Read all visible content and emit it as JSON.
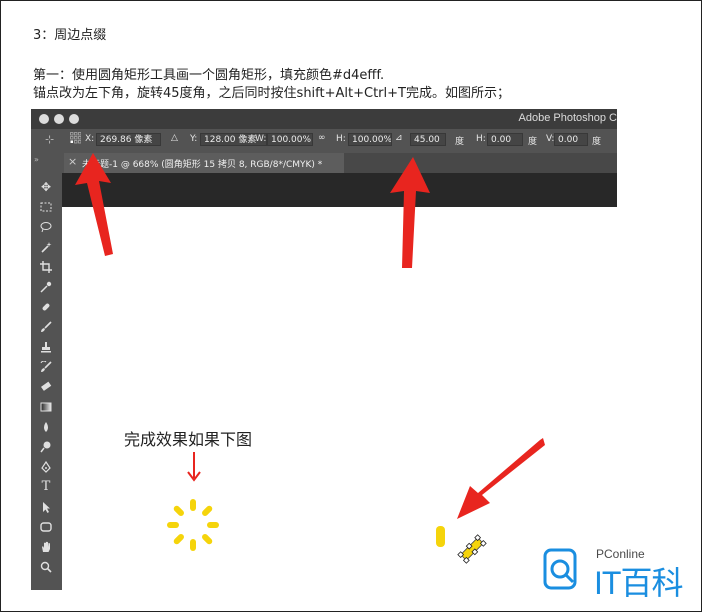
{
  "article": {
    "heading": "3：周边点缀",
    "step_line": "第一：使用圆角矩形工具画一个圆角矩形，填充颜色#d4efff.",
    "instruction_line": "锚点改为左下角，旋转45度角，之后同时按住shift+Alt+Ctrl+T完成。如图所示；",
    "result_caption": "完成效果如果下图"
  },
  "photoshop": {
    "app_title": "Adobe Photoshop C",
    "options": {
      "x_label": "X:",
      "x_value": "269.86 像素",
      "y_label": "Y:",
      "y_value": "128.00 像素",
      "w_label": "W:",
      "w_value": "100.00%",
      "h_label": "H:",
      "h_value": "100.00%",
      "angle_value": "45.00",
      "angle_unit": "度",
      "hskew_label": "H:",
      "hskew_value": "0.00",
      "hskew_unit": "度",
      "vskew_label": "V:",
      "vskew_value": "0.00",
      "vskew_unit": "度"
    },
    "tab_label": "未标题-1 @ 668% (圆角矩形 15 拷贝 8, RGB/8*/CMYK) *",
    "tools": [
      "move-tool",
      "marquee-tool",
      "lasso-tool",
      "magic-wand-tool",
      "crop-tool",
      "eyedropper-tool",
      "healing-tool",
      "brush-tool",
      "stamp-tool",
      "history-brush-tool",
      "eraser-tool",
      "gradient-tool",
      "blur-tool",
      "dodge-tool",
      "pen-tool",
      "type-tool",
      "path-select-tool",
      "shape-tool",
      "hand-tool",
      "zoom-tool"
    ],
    "type_tool_glyph": "T"
  },
  "watermark": {
    "site": "PConline",
    "brand": "IT百科"
  },
  "colors": {
    "arrow": "#e8251f",
    "sunburst": "#f5d40b",
    "accent_blue": "#1a8ee0"
  }
}
